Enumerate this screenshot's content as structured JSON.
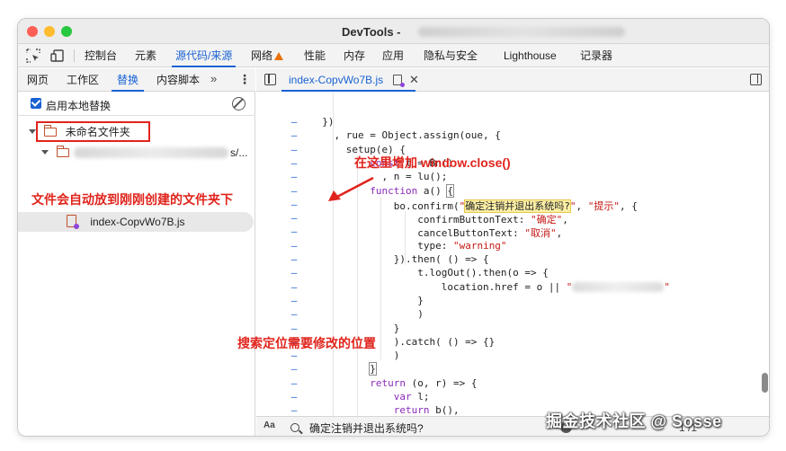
{
  "window": {
    "title": "DevTools -"
  },
  "main_tabs": [
    {
      "label": "控制台"
    },
    {
      "label": "元素"
    },
    {
      "label": "源代码/来源"
    },
    {
      "label": "网络"
    },
    {
      "label": "性能"
    },
    {
      "label": "内存"
    },
    {
      "label": "应用"
    },
    {
      "label": "隐私与安全"
    },
    {
      "label": "Lighthouse"
    },
    {
      "label": "记录器"
    }
  ],
  "sources_tabs": [
    {
      "label": "网页"
    },
    {
      "label": "工作区"
    },
    {
      "label": "替换"
    },
    {
      "label": "内容脚本"
    }
  ],
  "more_tabs": "»",
  "overrides": {
    "enable_label": "启用本地替换",
    "folder_name": "未命名文件夹",
    "subfolder_suffix": "s/...",
    "file_name": "index-CopvWo7B.js"
  },
  "editor": {
    "tab_label": "index-CopvWo7B.js",
    "lines": [
      {
        "marker": "–",
        "text": "  })"
      },
      {
        "marker": "–",
        "text": "    , rue = Object.assign(oue, {"
      },
      {
        "marker": "–",
        "text": "      setup(e) {"
      },
      {
        "marker": "–",
        "text": "          const t = Bn()"
      },
      {
        "marker": "–",
        "text": "            , n = lu();"
      },
      {
        "marker": "–",
        "text": "          function a() {"
      },
      {
        "marker": "–",
        "text": "              bo.confirm(\""
      },
      {
        "marker": "–",
        "text": "                  confirmButtonText: \"确定\","
      },
      {
        "marker": "–",
        "text": "                  cancelButtonText: \"取消\","
      },
      {
        "marker": "–",
        "text": "                  type: \"warning\""
      },
      {
        "marker": "–",
        "text": "              }).then( () => {"
      },
      {
        "marker": "–",
        "text": "                  t.logOut().then(o => {"
      },
      {
        "marker": "–",
        "text": "                      location.href = o || \""
      },
      {
        "marker": "–",
        "text": "                  }"
      },
      {
        "marker": "–",
        "text": "                  )"
      },
      {
        "marker": "–",
        "text": "              }"
      },
      {
        "marker": "–",
        "text": "              ).catch( () => {}"
      },
      {
        "marker": "–",
        "text": "              )"
      },
      {
        "marker": "–",
        "text": "          }"
      },
      {
        "marker": "–",
        "text": "          return (o, r) => {"
      },
      {
        "marker": "–",
        "text": "              var l;"
      },
      {
        "marker": "–",
        "text": "              return b(),"
      }
    ],
    "confirm_highlight": "确定注销并退出系统吗?",
    "confirm_rest": "\", \"提示\", {"
  },
  "search": {
    "aa_label": "Aa",
    "query": "确定注销并退出系统吗?",
    "match_count": "1 /1"
  },
  "annotations": {
    "left_note": "文件会自动放到刚刚创建的文件夹下",
    "right_note": "在这里增加 window.close()",
    "bottom_note": "搜索定位需要修改的位置"
  },
  "watermark": "掘金技术社区 @ Sosse",
  "colors": {
    "accent": "#1a62d3",
    "annotation_red": "#e0241c",
    "keyword": "#8a2bb9",
    "string": "#c41a16",
    "folder_icon": "#c0502d"
  },
  "icons": {
    "inspect": "inspect-element-icon",
    "device": "device-toolbar-icon",
    "warning": "warning-icon",
    "clear": "clear-overrides-icon",
    "sidebar_toggle": "sidebar-toggle-icon",
    "search": "search-icon"
  }
}
